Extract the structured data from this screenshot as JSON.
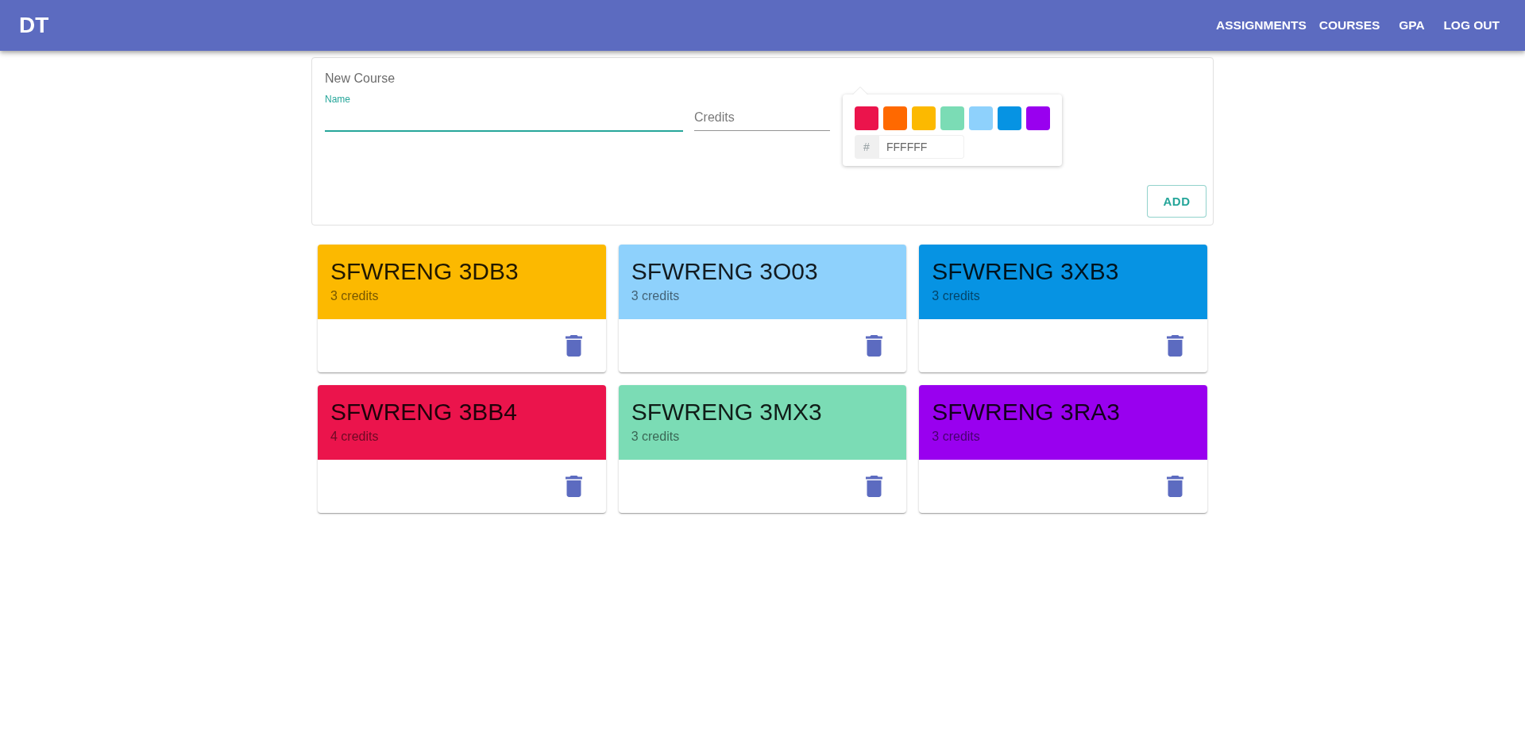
{
  "app_bar": {
    "logo": "DT",
    "nav": [
      "ASSIGNMENTS",
      "COURSES",
      "GPA",
      "LOG OUT"
    ]
  },
  "new_course_form": {
    "title": "New Course",
    "name_field": {
      "label": "Name",
      "focused": true
    },
    "credits_field": {
      "placeholder": "Credits"
    },
    "color_picker": {
      "swatches": [
        {
          "color": "#eb144c"
        },
        {
          "color": "#ff6900"
        },
        {
          "color": "#fcb900"
        },
        {
          "color": "#7bdcb5"
        },
        {
          "color": "#8ed1fc"
        },
        {
          "color": "#0693e3"
        },
        {
          "color": "#9900ef"
        }
      ],
      "hash": "#",
      "hex_value": "FFFFFF"
    },
    "add_button": "ADD"
  },
  "courses": [
    {
      "name": "SFWRENG 3DB3",
      "credits": "3 credits",
      "color": "#fcb900"
    },
    {
      "name": "SFWRENG 3O03",
      "credits": "3 credits",
      "color": "#8ed1fc"
    },
    {
      "name": "SFWRENG 3XB3",
      "credits": "3 credits",
      "color": "#0693e3"
    },
    {
      "name": "SFWRENG 3BB4",
      "credits": "4 credits",
      "color": "#eb144c"
    },
    {
      "name": "SFWRENG 3MX3",
      "credits": "3 credits",
      "color": "#7bdcb5"
    },
    {
      "name": "SFWRENG 3RA3",
      "credits": "3 credits",
      "color": "#9900ef"
    }
  ]
}
